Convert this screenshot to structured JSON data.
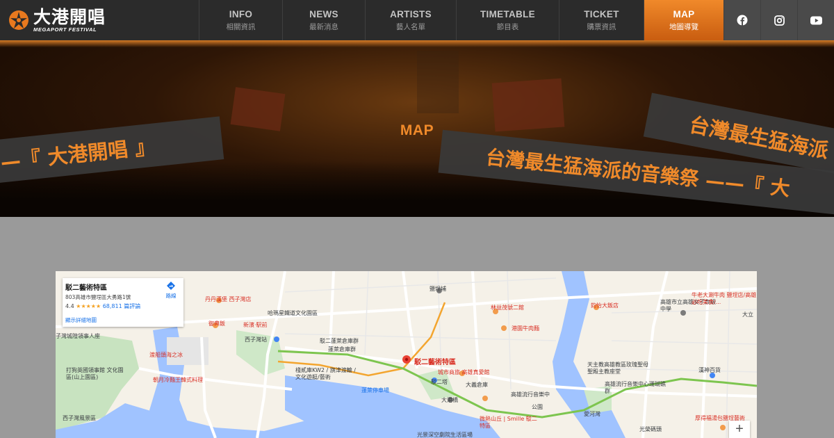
{
  "brand": {
    "name_zh": "大港開唱",
    "name_en": "MEGAPORT FESTIVAL"
  },
  "nav": [
    {
      "en": "INFO",
      "zh": "相關資訊"
    },
    {
      "en": "NEWS",
      "zh": "最新消息"
    },
    {
      "en": "ARTISTS",
      "zh": "藝人名單"
    },
    {
      "en": "TIMETABLE",
      "zh": "節目表"
    },
    {
      "en": "TICKET",
      "zh": "購票資訊"
    },
    {
      "en": "MAP",
      "zh": "地圖導覽",
      "active": true
    }
  ],
  "social": [
    "facebook-icon",
    "instagram-icon",
    "youtube-icon"
  ],
  "hero": {
    "title": "MAP",
    "band_left": "—『 大港開唱 』",
    "band_right_top": "台灣最生猛海派",
    "band_right_bottom": "台灣最生猛海派的音樂祭 ——『 大"
  },
  "map": {
    "card": {
      "title": "駁二藝術特區",
      "address": "803高雄市鹽埕區大勇路1號",
      "rating": "4.4",
      "stars": "★★★★★",
      "reviews": "68,811 篇評論",
      "more": "顯示詳細地圖",
      "directions": "路線"
    },
    "zoom_in": "+",
    "labels": [
      {
        "name": "label-pier2",
        "text": "駁二藝術特區",
        "color": "#d93025"
      },
      {
        "name": "label-yancheng",
        "text": "鹽埕埔",
        "color": "#3c4043"
      },
      {
        "name": "label-linmaoshen",
        "text": "林益茂號二館",
        "color": "#d93025"
      },
      {
        "name": "label-gangchengniu",
        "text": "港園牛肉麵",
        "color": "#d93025"
      },
      {
        "name": "label-penglai",
        "text": "蓬萊倉庫群",
        "color": "#3c4043"
      },
      {
        "name": "label-city-museum",
        "text": "城市商旅 高雄真愛館",
        "color": "#d93025"
      },
      {
        "name": "label-dayi",
        "text": "大義倉庫",
        "color": "#3c4043"
      },
      {
        "name": "label-dagang",
        "text": "大港橋",
        "color": "#3c4043"
      },
      {
        "name": "label-penglai-parking",
        "text": "蓬萊停車場",
        "color": "#1a73e8"
      },
      {
        "name": "label-hamasen",
        "text": "哈瑪星鐵道文化園區",
        "color": "#3c4043"
      },
      {
        "name": "label-sizihwan",
        "text": "西子灣站",
        "color": "#3c4043"
      },
      {
        "name": "label-xinbin",
        "text": "新濱·駅前",
        "color": "#d93025"
      },
      {
        "name": "label-yufanshi",
        "text": "御典飯",
        "color": "#d93025"
      },
      {
        "name": "label-dan",
        "text": "丹丹漢堡 西子灣店",
        "color": "#d93025"
      },
      {
        "name": "label-zhaoyue",
        "text": "朝月冷麵王韓式料理",
        "color": "#d93025"
      },
      {
        "name": "label-bozhi",
        "text": "渡船頭海之冰",
        "color": "#d93025"
      },
      {
        "name": "label-uk-consulate",
        "text": "打狗英國領事館 文化園區(山上園區)",
        "color": "#3c4043"
      },
      {
        "name": "label-sizihwan-park",
        "text": "西子灣風景區",
        "color": "#3c4043"
      },
      {
        "name": "label-sizihwan-peace",
        "text": "子灣城隍領事人座",
        "color": "#3c4043"
      },
      {
        "name": "label-kw2",
        "text": "棧貳庫KW2 / 旗津渡輪 / 文化遊艇/藝術",
        "color": "#3c4043"
      },
      {
        "name": "label-pier2-station",
        "text": "駁二塔",
        "color": "#3c4043"
      },
      {
        "name": "label-smile",
        "text": "微熱山丘 | Smille 駁二特區",
        "color": "#d93025"
      },
      {
        "name": "label-weng",
        "text": "駁二蓬萊倉庫群",
        "color": "#3c4043"
      },
      {
        "name": "label-ambassador",
        "text": "鈞怡大飯店",
        "color": "#d93025"
      },
      {
        "name": "label-highschool",
        "text": "高雄市立高雄女子高級中學",
        "color": "#3c4043"
      },
      {
        "name": "label-rosary",
        "text": "天主教高雄教區玫瑰聖母聖殿主教座堂",
        "color": "#3c4043"
      },
      {
        "name": "label-music-center",
        "text": "高雄流行音樂中心珊瑚礁群",
        "color": "#3c4043"
      },
      {
        "name": "label-aihe",
        "text": "愛河灣",
        "color": "#3c4043"
      },
      {
        "name": "label-hanshin",
        "text": "漢神百貨",
        "color": "#3c4043"
      },
      {
        "name": "label-niu",
        "text": "牛老大涮牛肉 鹽埕店/高雄必吃美食/...",
        "color": "#d93025"
      },
      {
        "name": "label-buqu",
        "text": "厚得福湯包鹽埕藝術",
        "color": "#d93025"
      },
      {
        "name": "label-dali",
        "text": "大立",
        "color": "#3c4043"
      },
      {
        "name": "label-guangrong",
        "text": "光榮碼頭",
        "color": "#3c4043"
      },
      {
        "name": "label-gaoxiong-music",
        "text": "高雄流行音樂中",
        "color": "#3c4043"
      },
      {
        "name": "label-park",
        "text": "公園",
        "color": "#3c4043"
      },
      {
        "name": "label-pier2-cafe",
        "text": "光景深空劇院生活區場",
        "color": "#3c4043"
      }
    ]
  }
}
